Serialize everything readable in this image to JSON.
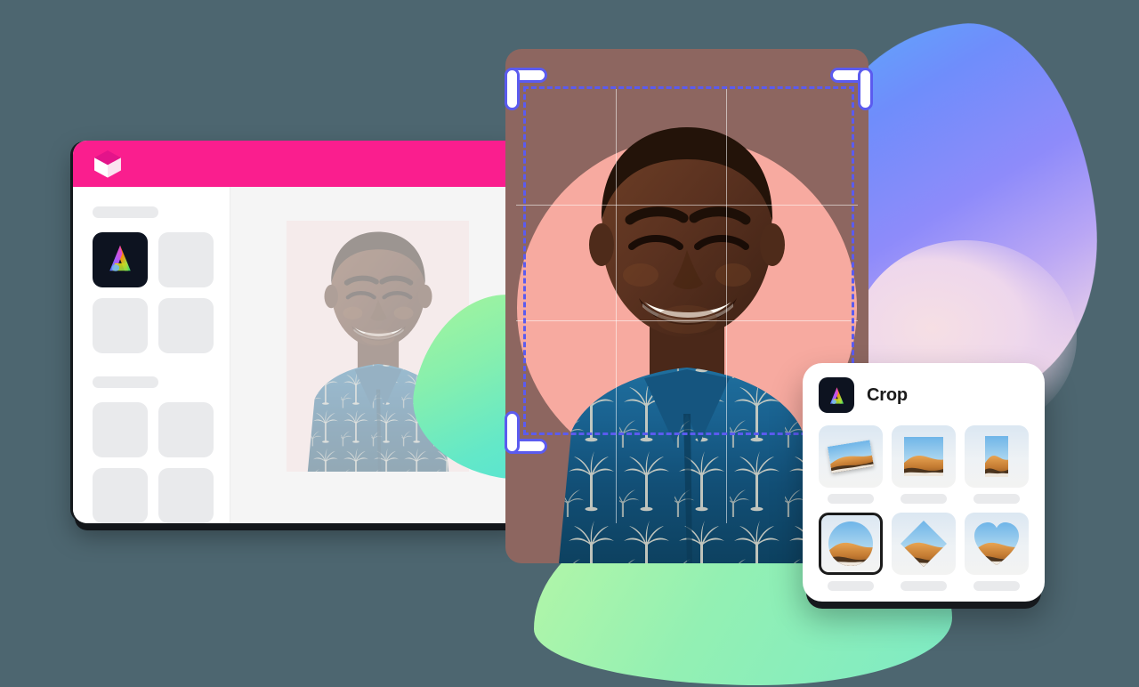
{
  "theme": {
    "page_background": "#4d6670",
    "accent_pink": "#fa1e8e",
    "crop_blue": "#5b5bef",
    "panel_dark": "#0d1320",
    "photo_backdrop": "#8d6660",
    "photo_circle": "#f7aaa0"
  },
  "app_window": {
    "titlebar": {
      "logo_icon": "cube-logo"
    },
    "sidebar": {
      "section_one_label": "",
      "section_two_label": "",
      "tiles": [
        {
          "name": "adobe-express-app-tile",
          "icon": "adobe-express-a-icon",
          "active": true
        },
        {
          "name": "placeholder-tile-2",
          "icon": "",
          "active": false
        },
        {
          "name": "placeholder-tile-3",
          "icon": "",
          "active": false
        },
        {
          "name": "placeholder-tile-4",
          "icon": "",
          "active": false
        },
        {
          "name": "placeholder-tile-5",
          "icon": "",
          "active": false
        },
        {
          "name": "placeholder-tile-6",
          "icon": "",
          "active": false
        },
        {
          "name": "placeholder-tile-7",
          "icon": "",
          "active": false
        },
        {
          "name": "placeholder-tile-8",
          "icon": "",
          "active": false
        }
      ]
    },
    "canvas": {
      "artboard_name": "portrait-artboard"
    }
  },
  "editor": {
    "photo_name": "smiling-man-hawaiian-shirt-portrait",
    "crop_overlay": {
      "style": "dashed",
      "grid": "rule-of-thirds",
      "handles": [
        "top-left",
        "top-right",
        "bottom-left"
      ]
    }
  },
  "crop_panel": {
    "app_icon": "adobe-express-a-icon",
    "title": "Crop",
    "options": [
      {
        "id": "freeform",
        "shape": "rotated-rectangle",
        "icon": "crop-freeform-icon",
        "selected": false
      },
      {
        "id": "square",
        "shape": "square",
        "icon": "crop-square-icon",
        "selected": false
      },
      {
        "id": "portrait",
        "shape": "portrait",
        "icon": "crop-portrait-icon",
        "selected": false
      },
      {
        "id": "circle",
        "shape": "circle",
        "icon": "crop-circle-icon",
        "selected": true
      },
      {
        "id": "diamond",
        "shape": "diamond",
        "icon": "crop-diamond-icon",
        "selected": false
      },
      {
        "id": "heart",
        "shape": "heart",
        "icon": "crop-heart-icon",
        "selected": false
      }
    ]
  },
  "decor": {
    "blobs": [
      {
        "name": "blue-purple-blob",
        "colors": [
          "#5fa8fb",
          "#8e8bfa",
          "#e8cfe9"
        ]
      },
      {
        "name": "green-teal-blob",
        "colors": [
          "#a8f59a",
          "#55e2d6"
        ]
      },
      {
        "name": "green-bottom-blob",
        "colors": [
          "#b7f7a6",
          "#7eebc5"
        ]
      }
    ]
  }
}
